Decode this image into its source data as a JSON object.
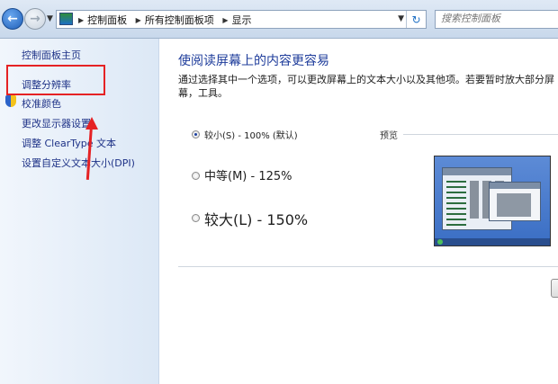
{
  "address_bar": {
    "breadcrumbs": [
      "控制面板",
      "所有控制面板项",
      "显示"
    ],
    "search_placeholder": "搜索控制面板"
  },
  "sidebar": {
    "items": [
      {
        "label": "控制面板主页"
      },
      {
        "label": "调整分辨率"
      },
      {
        "label": "校准颜色"
      },
      {
        "label": "更改显示器设置"
      },
      {
        "label": "调整 ClearType 文本"
      },
      {
        "label": "设置自定义文本大小(DPI)"
      }
    ]
  },
  "main": {
    "title": "使阅读屏幕上的内容更容易",
    "description": "通过选择其中一个选项，可以更改屏幕上的文本大小以及其他项。若要暂时放大部分屏幕，工具。",
    "options": [
      {
        "label": "较小(S) - 100% (默认)",
        "checked": true
      },
      {
        "label": "中等(M) - 125%",
        "checked": false
      },
      {
        "label": "较大(L) - 150%",
        "checked": false
      }
    ],
    "preview_label": "预览"
  },
  "colors": {
    "title_blue": "#1e3c9b",
    "link_blue": "#1e3287",
    "highlight_red": "#e52224"
  }
}
